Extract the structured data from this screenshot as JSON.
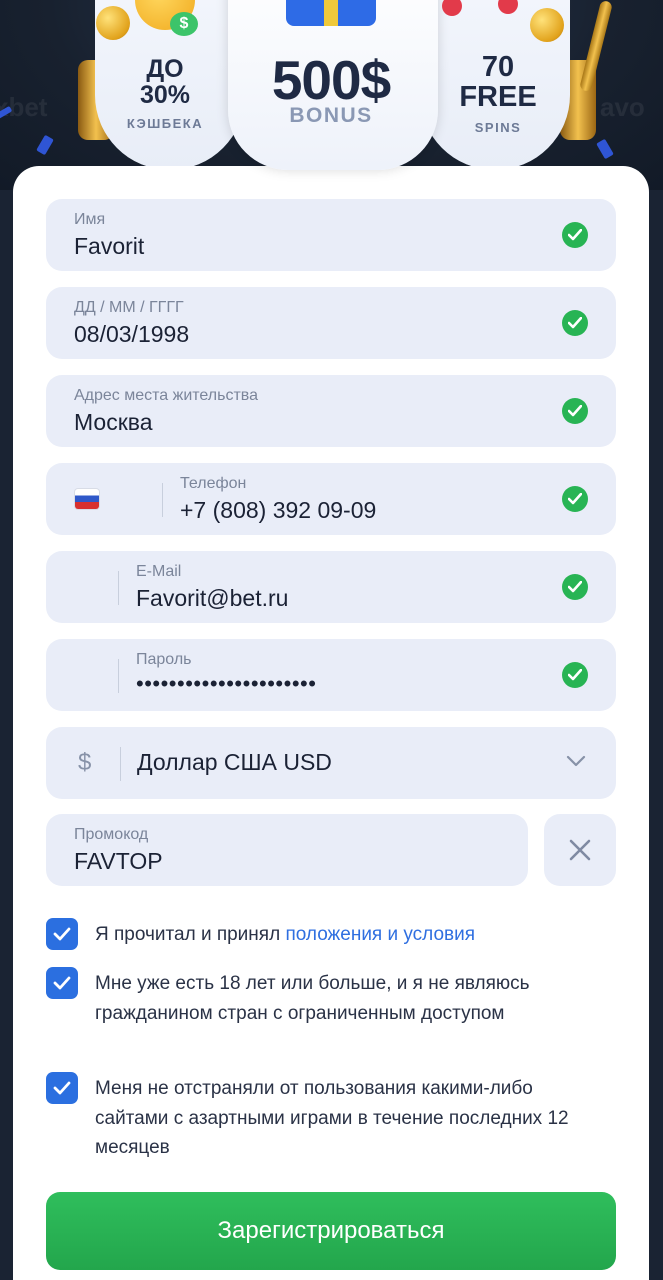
{
  "banner": {
    "cashback_top": "ДО",
    "cashback_value": "30%",
    "cashback_label": "КЭШБЕКА",
    "bonus_value": "500$",
    "bonus_label": "BONUS",
    "spins_value": "70",
    "spins_free": "FREE",
    "spins_label": "SPINS"
  },
  "form": {
    "name": {
      "label": "Имя",
      "value": "Favorit"
    },
    "birthdate": {
      "label": "ДД / ММ / ГГГГ",
      "value": "08/03/1998"
    },
    "address": {
      "label": "Адрес места жительства",
      "value": "Москва"
    },
    "phone": {
      "label": "Телефон",
      "value": "+7 (808) 392 09-09",
      "country_flag": "russia-flag-icon"
    },
    "email": {
      "label": "E-Mail",
      "value": "Favorit@bet.ru"
    },
    "password": {
      "label": "Пароль",
      "value": "••••••••••••••••••••••"
    },
    "currency": {
      "symbol": "$",
      "value": "Доллар США USD"
    },
    "promo": {
      "label": "Промокод",
      "value": "FAVTOP"
    },
    "checkboxes": [
      {
        "text": "Я прочитал и принял ",
        "link": "положения и условия",
        "checked": true
      },
      {
        "text": "Мне уже есть 18 лет или больше, и я не являюсь гражданином стран с ограниченным доступом",
        "checked": true
      },
      {
        "text": "Меня не отстраняли от пользования какими-либо сайтами с азартными играми в течение последних 12 месяцев",
        "checked": true
      }
    ],
    "submit_label": "Зарегистрироваться"
  },
  "colors": {
    "accent_green": "#28b454",
    "checkbox_blue": "#2b6fe0",
    "field_bg": "#e9edf8",
    "page_bg": "#1a2333"
  }
}
